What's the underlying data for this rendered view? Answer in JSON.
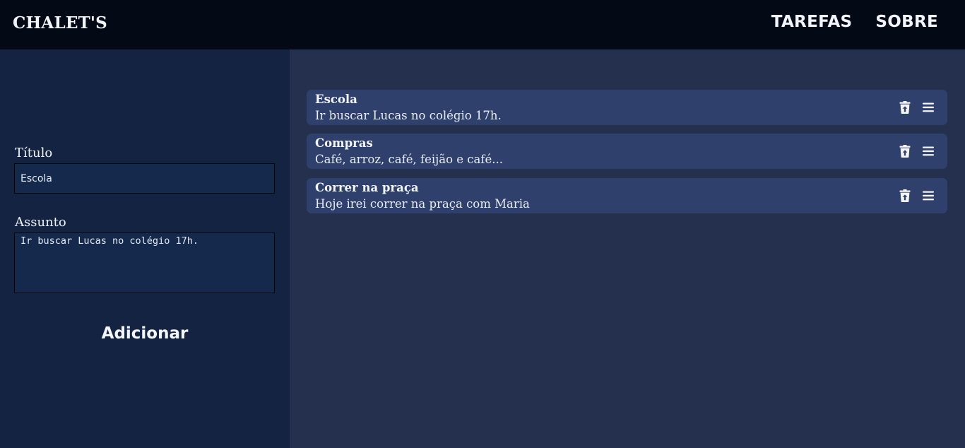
{
  "header": {
    "brand": "CHALET'S",
    "nav": [
      {
        "label": "TAREFAS"
      },
      {
        "label": "SOBRE"
      }
    ]
  },
  "form": {
    "title_label": "Título",
    "title_value": "Escola",
    "subject_label": "Assunto",
    "subject_value": "Ir buscar Lucas no colégio 17h.",
    "add_label": "Adicionar"
  },
  "tasks": [
    {
      "title": "Escola",
      "description": "Ir buscar Lucas no colégio 17h.",
      "icons": [
        "trash-restore-icon",
        "menu-icon"
      ]
    },
    {
      "title": "Compras",
      "description": "Café, arroz, café, feijão e café...",
      "icons": [
        "trash-restore-icon",
        "menu-icon"
      ]
    },
    {
      "title": "Correr na praça",
      "description": "Hoje irei correr na praça com Maria",
      "icons": [
        "trash-restore-icon",
        "menu-icon"
      ]
    }
  ],
  "colors": {
    "header_bg": "#030a16",
    "sidebar_bg": "#132341",
    "main_bg": "#25304f",
    "card_bg": "#30406c",
    "text": "#f3f5fa"
  }
}
